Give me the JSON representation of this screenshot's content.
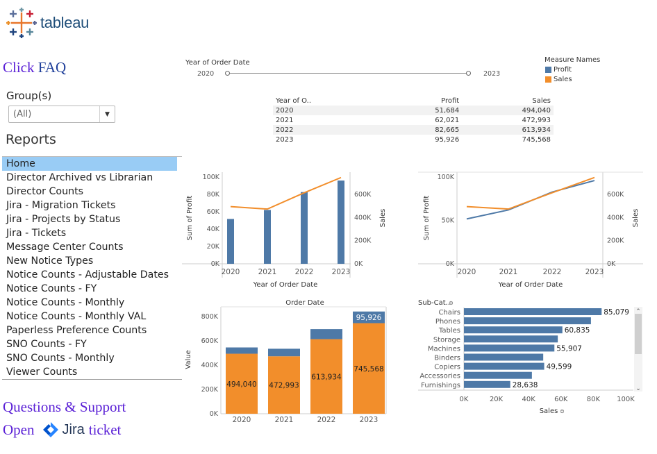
{
  "brand": {
    "logo_text": "tableau"
  },
  "sidebar": {
    "faq_prefix": "Click",
    "faq_link": "FAQ",
    "group_label": "Group(s)",
    "group_value": "(All)",
    "reports_title": "Reports",
    "reports": [
      {
        "label": "Home",
        "active": true
      },
      {
        "label": "Director Archived vs Librarian"
      },
      {
        "label": "Director Counts"
      },
      {
        "label": "Jira - Migration Tickets"
      },
      {
        "label": "Jira - Projects by Status"
      },
      {
        "label": "Jira - Tickets"
      },
      {
        "label": "Message Center Counts"
      },
      {
        "label": "New Notice Types"
      },
      {
        "label": "Notice Counts - Adjustable Dates"
      },
      {
        "label": "Notice Counts - FY"
      },
      {
        "label": "Notice Counts - Monthly"
      },
      {
        "label": "Notice Counts - Monthly VAL"
      },
      {
        "label": "Paperless Preference Counts"
      },
      {
        "label": "SNO Counts - FY"
      },
      {
        "label": "SNO Counts - Monthly"
      },
      {
        "label": "Viewer Counts"
      }
    ],
    "support_text": "Questions & Support",
    "open_text": "Open",
    "jira_text": "Jira",
    "ticket_text": "ticket"
  },
  "filter": {
    "title": "Year of Order Date",
    "min_label": "2020",
    "max_label": "2023"
  },
  "legend": {
    "title": "Measure Names",
    "items": [
      {
        "label": "Profit",
        "color": "#4e79a7"
      },
      {
        "label": "Sales",
        "color": "#f28e2b"
      }
    ]
  },
  "colors": {
    "profit": "#4e79a7",
    "sales": "#f28e2b",
    "selection": "#99ccf5"
  },
  "summary_table": {
    "headers": [
      "Year of O..",
      "Profit",
      "Sales"
    ],
    "rows": [
      [
        "2020",
        "51,684",
        "494,040"
      ],
      [
        "2021",
        "62,021",
        "472,993"
      ],
      [
        "2022",
        "82,665",
        "613,934"
      ],
      [
        "2023",
        "95,926",
        "745,568"
      ]
    ]
  },
  "chart_data": [
    {
      "type": "bar",
      "subtype": "dual-axis bar + line",
      "categories": [
        "2020",
        "2021",
        "2022",
        "2023"
      ],
      "series": [
        {
          "name": "Profit",
          "axis": "left",
          "mark": "bar",
          "values": [
            51684,
            62021,
            82665,
            95926
          ]
        },
        {
          "name": "Sales",
          "axis": "right",
          "mark": "line",
          "values": [
            494040,
            472993,
            613934,
            745568
          ]
        }
      ],
      "xlabel": "Year of Order Date",
      "ylabel": "Sum of Profit",
      "y2label": "Sales",
      "ylim": [
        0,
        100000
      ],
      "y2lim": [
        0,
        760000
      ],
      "yticks": [
        "0K",
        "20K",
        "40K",
        "60K",
        "80K",
        "100K"
      ],
      "y2ticks": [
        "0K",
        "200K",
        "400K",
        "600K"
      ]
    },
    {
      "type": "line",
      "subtype": "dual-axis line",
      "categories": [
        "2020",
        "2021",
        "2022",
        "2023"
      ],
      "series": [
        {
          "name": "Profit",
          "axis": "left",
          "values": [
            51684,
            62021,
            82665,
            95926
          ]
        },
        {
          "name": "Sales",
          "axis": "right",
          "values": [
            494040,
            472993,
            613934,
            745568
          ]
        }
      ],
      "xlabel": "Year of Order Date",
      "ylabel": "Sum of Profit",
      "y2label": "Sales",
      "ylim": [
        0,
        100000
      ],
      "y2lim": [
        0,
        760000
      ],
      "yticks": [
        "0K",
        "50K",
        "100K"
      ],
      "y2ticks": [
        "0K",
        "200K",
        "400K",
        "600K"
      ]
    },
    {
      "type": "bar",
      "subtype": "stacked",
      "title": "Order Date",
      "categories": [
        "2020",
        "2021",
        "2022",
        "2023"
      ],
      "series": [
        {
          "name": "Sales",
          "values": [
            494040,
            472993,
            613934,
            745568
          ]
        },
        {
          "name": "Profit",
          "values": [
            51684,
            62021,
            82665,
            95926
          ]
        }
      ],
      "bar_labels": [
        "494,040",
        "472,993",
        "613,934",
        "745,568"
      ],
      "top_label": "95,926",
      "ylabel": "Value",
      "ylim": [
        0,
        880000
      ],
      "yticks": [
        "0K",
        "200K",
        "400K",
        "600K",
        "800K"
      ]
    },
    {
      "type": "bar",
      "orientation": "horizontal",
      "header": "Sub-Cat..",
      "categories": [
        "Chairs",
        "Phones",
        "Tables",
        "Storage",
        "Machines",
        "Binders",
        "Copiers",
        "Accessories",
        "Furnishings"
      ],
      "values": [
        85079,
        78500,
        60835,
        58000,
        55907,
        49000,
        49599,
        42000,
        28638
      ],
      "value_labels": [
        "85,079",
        "",
        "60,835",
        "",
        "55,907",
        "",
        "49,599",
        "",
        "28,638"
      ],
      "xlabel": "Sales",
      "xlim": [
        0,
        100000
      ],
      "xticks": [
        "0K",
        "20K",
        "40K",
        "60K",
        "80K",
        "100K"
      ]
    }
  ]
}
